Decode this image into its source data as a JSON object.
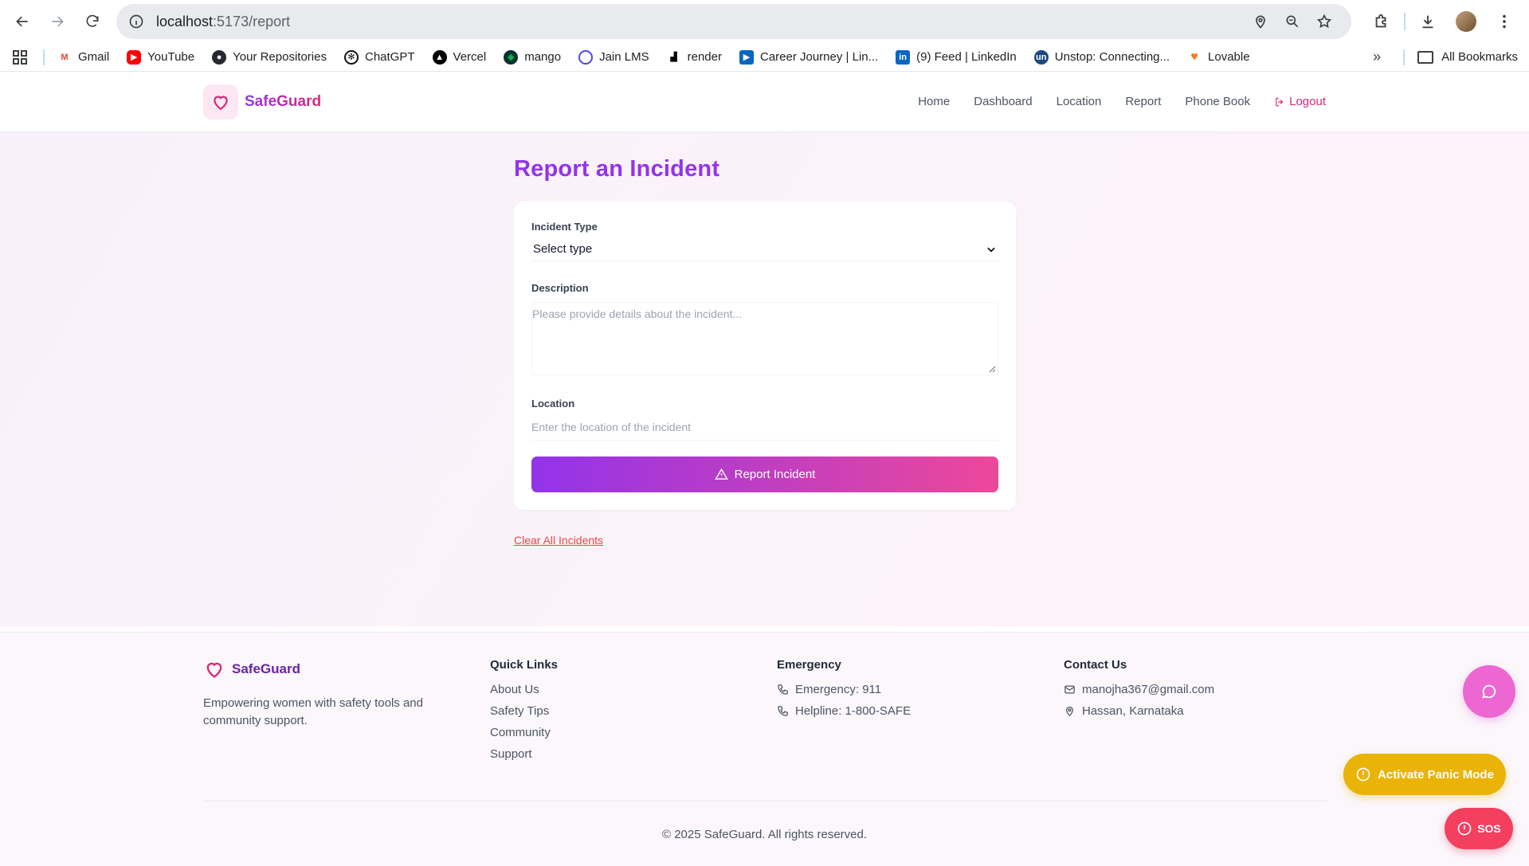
{
  "browser": {
    "url_host": "localhost",
    "url_path": ":5173/report",
    "bookmarks": [
      {
        "label": "Gmail",
        "icon": "gmail-icon",
        "color": "#ea4335"
      },
      {
        "label": "YouTube",
        "icon": "youtube-icon",
        "color": "#ff0000"
      },
      {
        "label": "Your Repositories",
        "icon": "github-icon",
        "color": "#24292f"
      },
      {
        "label": "ChatGPT",
        "icon": "chatgpt-icon",
        "color": "#111111"
      },
      {
        "label": "Vercel",
        "icon": "vercel-icon",
        "color": "#000000"
      },
      {
        "label": "mango",
        "icon": "mongodb-icon",
        "color": "#13aa52"
      },
      {
        "label": "Jain LMS",
        "icon": "circle-icon",
        "color": "#4f46e5"
      },
      {
        "label": "render",
        "icon": "render-icon",
        "color": "#000000"
      },
      {
        "label": "Career Journey | Lin...",
        "icon": "play-icon",
        "color": "#0a66c2"
      },
      {
        "label": "(9) Feed | LinkedIn",
        "icon": "linkedin-icon",
        "color": "#0a66c2"
      },
      {
        "label": "Unstop: Connecting...",
        "icon": "unstop-icon",
        "color": "#1c4980"
      },
      {
        "label": "Lovable",
        "icon": "heart-icon",
        "color": "#f97316"
      }
    ],
    "all_bookmarks": "All Bookmarks"
  },
  "header": {
    "brand": "SafeGuard",
    "nav": [
      "Home",
      "Dashboard",
      "Location",
      "Report",
      "Phone Book"
    ],
    "logout": "Logout"
  },
  "form": {
    "title": "Report an Incident",
    "incident_type_label": "Incident Type",
    "incident_type_value": "Select type",
    "description_label": "Description",
    "description_placeholder": "Please provide details about the incident...",
    "location_label": "Location",
    "location_placeholder": "Enter the location of the incident",
    "submit_label": "Report Incident",
    "clear_label": "Clear All Incidents"
  },
  "footer": {
    "brand": "SafeGuard",
    "tagline": "Empowering women with safety tools and community support.",
    "quick_links_heading": "Quick Links",
    "quick_links": [
      "About Us",
      "Safety Tips",
      "Community",
      "Support"
    ],
    "emergency_heading": "Emergency",
    "emergency": "Emergency: 911",
    "helpline": "Helpline: 1-800-SAFE",
    "contact_heading": "Contact Us",
    "email": "manojha367@gmail.com",
    "address": "Hassan, Karnataka",
    "copyright": "© 2025 SafeGuard. All rights reserved."
  },
  "floating": {
    "panic_label": "Activate Panic Mode",
    "sos_label": "SOS"
  },
  "colors": {
    "accent_purple": "#9333ea",
    "accent_pink": "#ec4899",
    "panic_yellow": "#eab308",
    "sos_red": "#f43f5e"
  }
}
